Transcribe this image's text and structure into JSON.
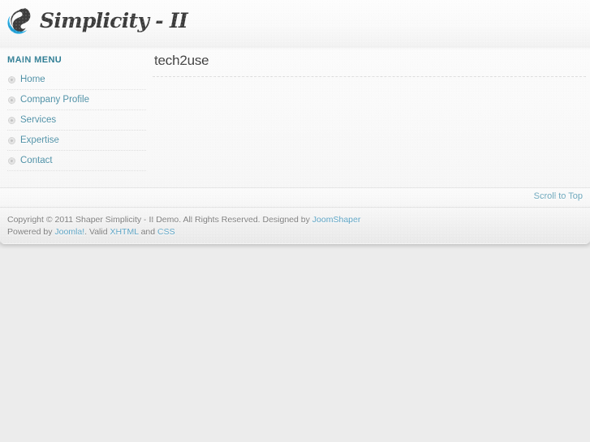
{
  "site": {
    "logo_text": "Simplicity - II",
    "logo_icon": "yin-yang-swirl-icon"
  },
  "sidebar": {
    "title": "MAIN MENU",
    "items": [
      {
        "label": "Home",
        "icon": "bullet-circle-icon"
      },
      {
        "label": "Company Profile",
        "icon": "bullet-circle-icon"
      },
      {
        "label": "Services",
        "icon": "bullet-circle-icon"
      },
      {
        "label": "Expertise",
        "icon": "bullet-circle-icon"
      },
      {
        "label": "Contact",
        "icon": "bullet-circle-icon"
      }
    ]
  },
  "content": {
    "page_title": "tech2use",
    "body_text": ""
  },
  "totop": {
    "label": "Scroll to Top"
  },
  "footer": {
    "line1_part1": "Copyright © 2011 Shaper Simplicity - II Demo. All Rights Reserved. Designed by ",
    "line1_link": "JoomShaper",
    "line2_part1": "Powered by ",
    "line2_link1": "Joomla!",
    "line2_part2": ". Valid ",
    "line2_link2": "XHTML",
    "line2_part3": " and ",
    "line2_link3": "CSS"
  },
  "colors": {
    "accent_blue": "#5ba3c4",
    "menu_link": "#4d8fa5",
    "menu_title": "#2d7c93",
    "logo_cyan": "#29abe2",
    "logo_dark": "#3b3b3b",
    "page_bg": "#ececec"
  }
}
